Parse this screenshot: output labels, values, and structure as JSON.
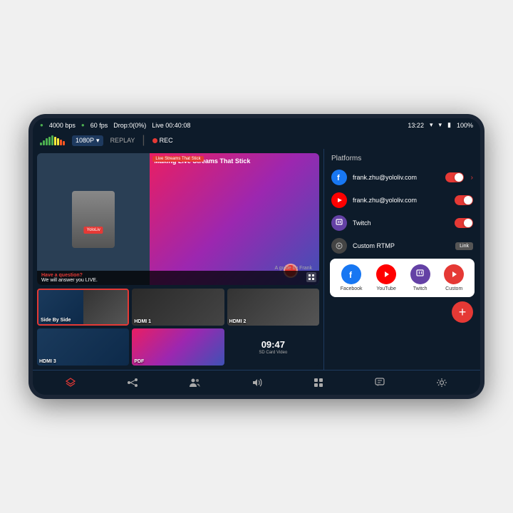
{
  "device": {
    "status_bar": {
      "bitrate": "4000 bps",
      "fps": "60 fps",
      "drop": "Drop:0(0%)",
      "live_duration": "Live 00:40:08",
      "time": "13:22",
      "battery": "100%"
    },
    "toolbar": {
      "resolution": "1080P",
      "replay": "REPLAY",
      "rec": "REC"
    },
    "platforms": {
      "header": "Platforms",
      "items": [
        {
          "id": "facebook",
          "type": "fb",
          "email": "frank.zhu@yololiv.com",
          "enabled": true,
          "has_chevron": true
        },
        {
          "id": "youtube",
          "type": "yt",
          "email": "frank.zhu@yololiv.com",
          "enabled": true,
          "has_chevron": false
        },
        {
          "id": "twitch",
          "type": "tw",
          "name": "Twitch",
          "enabled": true,
          "has_chevron": false
        },
        {
          "id": "rtmp",
          "type": "rtmp",
          "name": "Custom RTMP",
          "link": "Link"
        }
      ],
      "popup": {
        "items": [
          {
            "type": "fb",
            "label": "Facebook"
          },
          {
            "type": "yt",
            "label": "YouTube"
          },
          {
            "type": "tw",
            "label": "Twitch"
          },
          {
            "type": "custom",
            "label": "Custom"
          }
        ]
      },
      "add_button": "+"
    },
    "preview": {
      "live_badge": "Live Streams That Stick",
      "title": "Making Live Streams That Stick",
      "question": "Have a question?",
      "answer": "We will answer you LIVE."
    },
    "sources": [
      {
        "id": "sbs",
        "label": "Side By Side",
        "type": "sbs",
        "active": true
      },
      {
        "id": "hdmi1",
        "label": "HDMI 1",
        "type": "hdmi1"
      },
      {
        "id": "hdmi2",
        "label": "HDMI 2",
        "type": "hdmi2"
      },
      {
        "id": "hdmi3",
        "label": "HDMI 3",
        "type": "hdmi3"
      },
      {
        "id": "pdf",
        "label": "PDF",
        "type": "pdf"
      },
      {
        "id": "sd",
        "label": "SD Card Video",
        "time": "09:47",
        "type": "sd"
      }
    ],
    "nav": {
      "icons": [
        "layers",
        "share",
        "people",
        "volume",
        "grid",
        "chat",
        "settings"
      ]
    }
  }
}
